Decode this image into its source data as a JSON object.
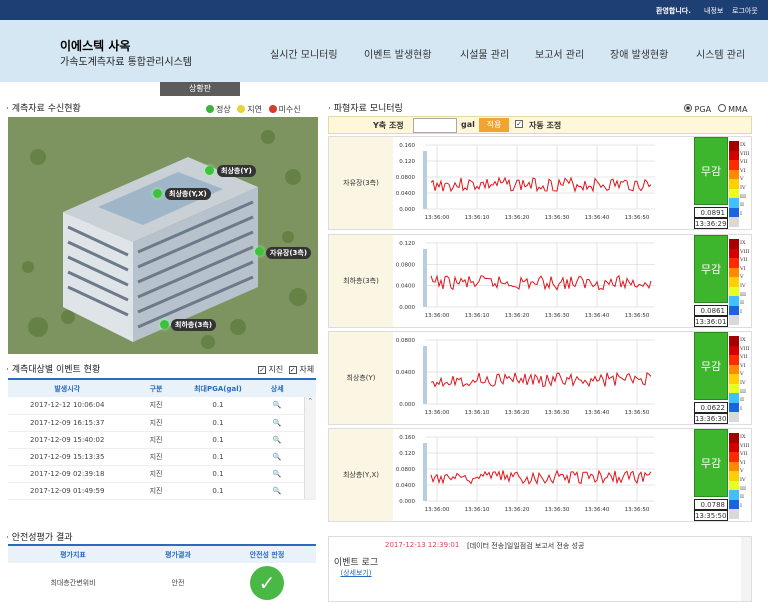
{
  "topbar": {
    "greeting": "환영합니다.",
    "myinfo": "내정보",
    "logout": "로그아웃"
  },
  "header": {
    "title": "이에스텍 사옥",
    "subtitle": "가속도계측자료 통합관리시스템"
  },
  "nav": [
    "실시간 모니터링",
    "이벤트 발생현황",
    "시설물 관리",
    "보고서 관리",
    "장애 발생현황",
    "시스템 관리"
  ],
  "tab": "상황판",
  "sections": {
    "receive": "· 계측자료 수신현황",
    "event": "· 계측대상별 이벤트 현황",
    "safety": "· 안전성평가 결과",
    "wave": "· 파형자료 모니터링"
  },
  "legend": {
    "normal": "정상",
    "delay": "지연",
    "missing": "미수신"
  },
  "sensors": [
    "최상층(Y)",
    "최상층(Y,X)",
    "자유장(3측)",
    "최하층(3측)"
  ],
  "event_filter": {
    "quake": "지진",
    "all": "자체"
  },
  "event_table": {
    "headers": [
      "발생시각",
      "구분",
      "최대PGA(gal)",
      "상세"
    ],
    "rows": [
      [
        "2017-12-12 10:06:04",
        "지진",
        "0.1"
      ],
      [
        "2017-12-09 16:15:37",
        "지진",
        "0.1"
      ],
      [
        "2017-12-09 15:40:02",
        "지진",
        "0.1"
      ],
      [
        "2017-12-09 15:13:35",
        "지진",
        "0.1"
      ],
      [
        "2017-12-09 02:39:18",
        "지진",
        "0.1"
      ],
      [
        "2017-12-09 01:49:59",
        "지진",
        "0.1"
      ]
    ]
  },
  "safety_table": {
    "headers": [
      "평가지표",
      "평가결과",
      "안전성 판정"
    ],
    "row": [
      "최대층간변위비",
      "안전"
    ]
  },
  "wave": {
    "pga": "PGA",
    "mma": "MMA",
    "yaxis": "Y축 조정",
    "unit": "gal",
    "apply": "적용",
    "auto": "자동 조정"
  },
  "panels": [
    {
      "label": "자유장(3측)",
      "status": "무감",
      "value": "0.0891",
      "time": "13:36:29",
      "ticks": [
        "0.160",
        "0.120",
        "0.0800",
        "0.0400",
        "0.000"
      ]
    },
    {
      "label": "최하층(3측)",
      "status": "무감",
      "value": "0.0861",
      "time": "13:36:01",
      "ticks": [
        "0.120",
        "0.0800",
        "0.0400",
        "0.000"
      ]
    },
    {
      "label": "최상층(Y)",
      "status": "무감",
      "value": "0.0622",
      "time": "13:36:30",
      "ticks": [
        "0.0800",
        "0.0400",
        "0.000"
      ]
    },
    {
      "label": "최상층(Y,X)",
      "status": "무감",
      "value": "0.0788",
      "time": "13:35:50",
      "ticks": [
        "0.160",
        "0.120",
        "0.0800",
        "0.0400",
        "0.000"
      ]
    }
  ],
  "xticks": [
    "13:36:00",
    "13:36:10",
    "13:36:20",
    "13:36:30",
    "13:36:40",
    "13:36:50"
  ],
  "scale_labels": [
    "IX",
    "VIII",
    "VII",
    "VI",
    "V",
    "IV",
    "III",
    "II",
    "I"
  ],
  "log": {
    "label": "이벤트 로그",
    "detail": "(상세보기)",
    "time": "2017-12-13 12:39:01",
    "message": "[데이터 전송]일일점검 보고서 전송 성공"
  }
}
